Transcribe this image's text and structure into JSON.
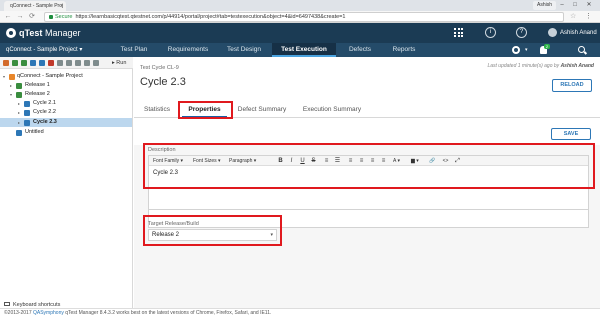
{
  "browser": {
    "tab_title": "qConnect - Sample Proj",
    "tab_close": "×",
    "window_user": "Ashish",
    "secure_label": "Secure",
    "url": "https://learnbasicqtest.qtestnet.com/p/44914/portal/project#tab=testexecution&object=4&id=6497438&create=1",
    "back_glyph": "←",
    "forward_glyph": "→",
    "refresh_glyph": "⟳",
    "star_glyph": "☆",
    "menu_glyph": "⋮",
    "min_glyph": "–",
    "max_glyph": "□",
    "close_glyph": "✕"
  },
  "app": {
    "brand": "qTest",
    "product": "Manager",
    "help_glyph": "?",
    "info_glyph": "i",
    "user": "Ashish Anand",
    "bell_count": "2"
  },
  "nav": {
    "project": "qConnect - Sample Project ▾",
    "modules": [
      "Test Plan",
      "Requirements",
      "Test Design",
      "Test Execution",
      "Defects",
      "Reports"
    ],
    "caret": "▾"
  },
  "tree": {
    "run_label": "▸ Run",
    "items": [
      {
        "label": "qConnect - Sample Project",
        "arrow": "▾"
      },
      {
        "label": "Release 1",
        "arrow": "▸"
      },
      {
        "label": "Release 2",
        "arrow": "▾"
      },
      {
        "label": "Cycle 2.1",
        "arrow": "▸"
      },
      {
        "label": "Cycle 2.2",
        "arrow": "▸"
      },
      {
        "label": "Cycle 2.3",
        "arrow": "▸"
      },
      {
        "label": "Untitled",
        "arrow": ""
      }
    ],
    "keyboard_shortcuts": "Keyboard shortcuts"
  },
  "main": {
    "test_cycle_id": "Test Cycle CL-9",
    "title": "Cycle 2.3",
    "last_updated_prefix": "Last updated 1 minute(s) ago by",
    "last_updated_user": "Ashish Anand",
    "reload": "RELOAD",
    "tabs": [
      "Statistics",
      "Properties",
      "Defect Summary",
      "Execution Summary"
    ],
    "save": "SAVE",
    "description_label": "Description",
    "editor": {
      "font_family": "Font Family ▾",
      "font_sizes": "Font Sizes ▾",
      "paragraph": "Paragraph ▾",
      "bold": "B",
      "italic": "I",
      "underline": "U",
      "strike": "S",
      "list_ul": "≡",
      "list_ol": "☰",
      "align_l": "≡",
      "align_c": "≡",
      "align_r": "≡",
      "align_j": "≡",
      "text_color": "A ▾",
      "highlight": "▆ ▾",
      "link": "🔗",
      "code": "<>",
      "fullscreen": "⤢",
      "content": "Cycle 2.3"
    },
    "target_label": "Target Release/Build",
    "target_value": "Release 2",
    "target_chev": "▾"
  },
  "footer": {
    "copyright": "©2013-2017",
    "brand": "QASymphony",
    "note": "  qTest Manager 8.4.3.2 works best on the latest versions of Chrome, Firefox, Safari, and IE11."
  },
  "colors": {
    "header_bg": "#1b3b54",
    "nav_bg": "#244b69",
    "accent": "#2d77b6",
    "highlight_box": "#e0191e",
    "selection": "#bcd7ee"
  }
}
